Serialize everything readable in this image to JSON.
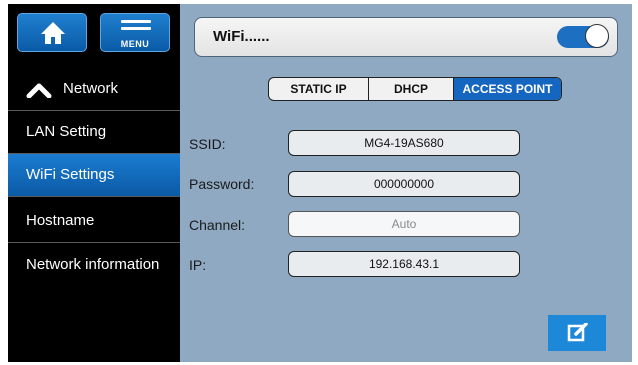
{
  "sidebar": {
    "home_icon": "home-icon",
    "menu_label": "MENU",
    "menu_icon": "hamburger-menu-icon",
    "network_label": "Network",
    "items": [
      {
        "label": "LAN Setting"
      },
      {
        "label": "WiFi Settings"
      },
      {
        "label": "Hostname"
      },
      {
        "label": "Network information"
      }
    ],
    "active_index": 1
  },
  "wifi": {
    "title": "WiFi......",
    "toggle_on": true
  },
  "modes": {
    "options": [
      "STATIC IP",
      "DHCP",
      "ACCESS POINT"
    ],
    "selected": "ACCESS POINT"
  },
  "fields": {
    "ssid": {
      "label": "SSID:",
      "value": "MG4-19AS680"
    },
    "password": {
      "label": "Password:",
      "value": "000000000"
    },
    "channel": {
      "label": "Channel:",
      "placeholder": "Auto"
    },
    "ip": {
      "label": "IP:",
      "value": "192.168.43.1"
    }
  },
  "edit_icon": "edit-icon",
  "colors": {
    "accent": "#1566c0",
    "background": "#8fa9c2",
    "sidebar": "#000000"
  }
}
